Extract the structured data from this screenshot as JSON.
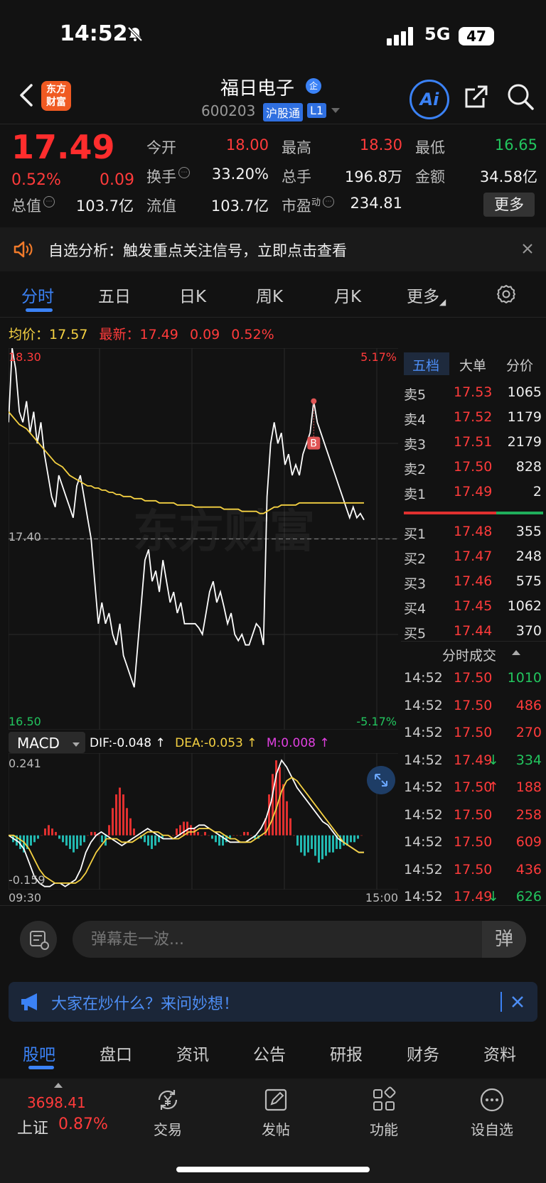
{
  "status": {
    "time": "14:52",
    "network": "5G",
    "battery": "47"
  },
  "header": {
    "logo_line1": "东方",
    "logo_line2": "财富",
    "name": "福日电子",
    "ent_badge": "企",
    "code": "600203",
    "badge_hgt": "沪股通",
    "badge_l1": "L1",
    "ai_label": "Ai"
  },
  "quote": {
    "price": "17.49",
    "change_pct": "0.52%",
    "change_amt": "0.09",
    "open_label": "今开",
    "open": "18.00",
    "high_label": "最高",
    "high": "18.30",
    "low_label": "最低",
    "low": "16.65",
    "turnover_label": "换手",
    "turnover": "33.20%",
    "volume_label": "总手",
    "volume": "196.8万",
    "amount_label": "金额",
    "amount": "34.58亿",
    "mcap_label": "总值",
    "mcap": "103.7亿",
    "float_label": "流值",
    "float_cap": "103.7亿",
    "pe_label": "市盈",
    "pe_sup": "动",
    "pe": "234.81",
    "more_label": "更多"
  },
  "notice": {
    "text": "自选分析：触发重点关注信号，立即点击查看"
  },
  "chart_tabs": [
    "分时",
    "五日",
    "日K",
    "周K",
    "月K",
    "更多"
  ],
  "avg_line": {
    "avg_label": "均价：",
    "avg": "17.57",
    "latest_label": "最新：",
    "latest": "17.49",
    "chg": "0.09",
    "pct": "0.52%"
  },
  "chart_data": [
    {
      "type": "line",
      "axis": {
        "y_top": "18.30",
        "y_mid": "17.40",
        "y_bottom": "16.50",
        "pct_top": "5.17%",
        "pct_bottom": "-5.17%",
        "x_start": "09:30",
        "x_end": "15:00",
        "ylim": [
          16.5,
          18.3
        ],
        "ref_price": 17.4
      },
      "watermark": "东方财富",
      "buy_marker": "B",
      "series": [
        {
          "color": "#ffffff",
          "values": [
            17.95,
            18.3,
            18.2,
            18.0,
            17.95,
            18.05,
            17.9,
            18.0,
            17.85,
            17.95,
            17.8,
            17.7,
            17.6,
            17.55,
            17.7,
            17.65,
            17.6,
            17.55,
            17.5,
            17.65,
            17.7,
            17.6,
            17.5,
            17.4,
            17.2,
            17.0,
            17.1,
            17.0,
            17.05,
            16.95,
            16.9,
            17.0,
            16.85,
            16.8,
            16.75,
            16.7,
            16.9,
            17.1,
            17.3,
            17.35,
            17.2,
            17.25,
            17.15,
            17.3,
            17.2,
            17.1,
            17.15,
            17.05,
            17.1,
            17.0,
            17.0,
            17.0,
            17.0,
            16.98,
            16.95,
            17.05,
            17.15,
            17.2,
            17.1,
            17.15,
            17.08,
            17.0,
            17.05,
            16.95,
            16.92,
            16.95,
            16.9,
            16.9,
            16.95,
            17.0,
            16.98,
            16.9,
            17.6,
            17.85,
            17.95,
            17.85,
            17.9,
            17.75,
            17.8,
            17.7,
            17.75,
            17.7,
            17.8,
            17.85,
            17.9,
            18.05,
            17.95,
            17.9,
            17.85,
            17.8,
            17.75,
            17.7,
            17.65,
            17.6,
            17.55,
            17.5,
            17.55,
            17.5,
            17.52,
            17.49
          ]
        },
        {
          "color": "#f5d142",
          "values": [
            18.0,
            17.98,
            17.96,
            17.94,
            17.93,
            17.92,
            17.9,
            17.88,
            17.86,
            17.84,
            17.82,
            17.8,
            17.78,
            17.76,
            17.75,
            17.74,
            17.72,
            17.7,
            17.69,
            17.68,
            17.67,
            17.66,
            17.65,
            17.65,
            17.64,
            17.64,
            17.63,
            17.63,
            17.62,
            17.62,
            17.61,
            17.61,
            17.6,
            17.6,
            17.6,
            17.59,
            17.59,
            17.59,
            17.58,
            17.58,
            17.58,
            17.58,
            17.57,
            17.57,
            17.57,
            17.57,
            17.57,
            17.56,
            17.56,
            17.56,
            17.56,
            17.56,
            17.55,
            17.55,
            17.55,
            17.55,
            17.55,
            17.55,
            17.55,
            17.55,
            17.54,
            17.54,
            17.54,
            17.54,
            17.54,
            17.53,
            17.53,
            17.53,
            17.53,
            17.53,
            17.52,
            17.52,
            17.53,
            17.54,
            17.55,
            17.55,
            17.56,
            17.56,
            17.56,
            17.56,
            17.56,
            17.57,
            17.57,
            17.57,
            17.57,
            17.57,
            17.57,
            17.57,
            17.57,
            17.57,
            17.57,
            17.57,
            17.57,
            17.57,
            17.57,
            17.57,
            17.57,
            17.57,
            17.57,
            17.57
          ]
        }
      ]
    },
    {
      "type": "bar",
      "title": "MACD",
      "axis": {
        "y_top": "0.241",
        "y_bottom": "-0.159",
        "x_start": "09:30",
        "x_end": "15:00",
        "ylim": [
          -0.159,
          0.241
        ]
      },
      "labels": {
        "dif": "DIF:-0.048 ↑",
        "dea": "DEA:-0.053 ↑",
        "m": "M:0.008 ↑"
      },
      "histogram": [
        0.0,
        -0.02,
        -0.03,
        -0.04,
        -0.05,
        -0.04,
        -0.03,
        -0.02,
        -0.01,
        0.0,
        0.02,
        0.03,
        0.02,
        0.01,
        -0.01,
        -0.02,
        -0.03,
        -0.04,
        -0.05,
        -0.04,
        -0.03,
        -0.02,
        0.0,
        0.01,
        0.01,
        0.0,
        -0.02,
        -0.03,
        0.03,
        0.08,
        0.12,
        0.14,
        0.12,
        0.08,
        0.05,
        0.02,
        0.0,
        -0.01,
        -0.02,
        -0.03,
        -0.04,
        -0.03,
        -0.02,
        -0.01,
        0.0,
        0.0,
        0.0,
        0.02,
        0.03,
        0.04,
        0.04,
        0.03,
        0.02,
        0.01,
        0.0,
        0.01,
        0.0,
        -0.01,
        -0.02,
        -0.03,
        -0.03,
        -0.02,
        -0.01,
        0.0,
        0.0,
        0.0,
        0.01,
        0.01,
        0.0,
        -0.01,
        -0.01,
        0.0,
        0.05,
        0.12,
        0.18,
        0.22,
        0.2,
        0.15,
        0.1,
        0.05,
        0.0,
        -0.03,
        -0.05,
        -0.06,
        -0.05,
        -0.04,
        -0.06,
        -0.08,
        -0.07,
        -0.06,
        -0.05,
        -0.05,
        -0.04,
        -0.04,
        -0.03,
        -0.03,
        -0.02,
        -0.02,
        -0.01,
        0.0
      ],
      "series": [
        {
          "name": "DIF",
          "color": "#ffffff",
          "values": [
            0.0,
            -0.01,
            -0.02,
            -0.04,
            -0.08,
            -0.12,
            -0.14,
            -0.15,
            -0.15,
            -0.14,
            -0.14,
            -0.15,
            -0.14,
            -0.13,
            -0.1,
            -0.05,
            -0.02,
            0.0,
            0.01,
            0.0,
            -0.01,
            -0.02,
            -0.03,
            -0.02,
            -0.01,
            0.0,
            0.01,
            0.02,
            0.01,
            0.0,
            -0.01,
            -0.01,
            -0.01,
            0.0,
            0.01,
            0.02,
            0.02,
            0.03,
            0.03,
            0.02,
            0.01,
            0.0,
            -0.01,
            -0.02,
            -0.02,
            -0.02,
            -0.02,
            -0.01,
            0.0,
            0.02,
            0.05,
            0.1,
            0.18,
            0.22,
            0.2,
            0.17,
            0.14,
            0.12,
            0.1,
            0.08,
            0.06,
            0.04,
            0.03,
            0.01,
            -0.01,
            -0.02,
            -0.03,
            -0.04,
            -0.05,
            -0.05
          ]
        },
        {
          "name": "DEA",
          "color": "#f5d142",
          "values": [
            0.0,
            0.0,
            -0.01,
            -0.02,
            -0.04,
            -0.07,
            -0.1,
            -0.12,
            -0.13,
            -0.14,
            -0.14,
            -0.14,
            -0.14,
            -0.14,
            -0.13,
            -0.11,
            -0.08,
            -0.05,
            -0.03,
            -0.01,
            -0.01,
            -0.01,
            -0.02,
            -0.02,
            -0.02,
            -0.01,
            0.0,
            0.01,
            0.01,
            0.01,
            0.0,
            0.0,
            -0.01,
            -0.01,
            0.0,
            0.01,
            0.01,
            0.02,
            0.02,
            0.02,
            0.01,
            0.01,
            0.0,
            -0.01,
            -0.01,
            -0.02,
            -0.02,
            -0.02,
            -0.01,
            0.0,
            0.01,
            0.04,
            0.08,
            0.13,
            0.16,
            0.17,
            0.16,
            0.14,
            0.12,
            0.1,
            0.08,
            0.06,
            0.04,
            0.02,
            0.0,
            -0.02,
            -0.03,
            -0.04,
            -0.05,
            -0.05
          ]
        }
      ]
    }
  ],
  "order_book": {
    "tabs": [
      "五档",
      "大单",
      "分价"
    ],
    "asks": [
      {
        "label": "卖5",
        "price": "17.53",
        "vol": "1065"
      },
      {
        "label": "卖4",
        "price": "17.52",
        "vol": "1179"
      },
      {
        "label": "卖3",
        "price": "17.51",
        "vol": "2179"
      },
      {
        "label": "卖2",
        "price": "17.50",
        "vol": "828"
      },
      {
        "label": "卖1",
        "price": "17.49",
        "vol": "2"
      }
    ],
    "bids": [
      {
        "label": "买1",
        "price": "17.48",
        "vol": "355"
      },
      {
        "label": "买2",
        "price": "17.47",
        "vol": "248"
      },
      {
        "label": "买3",
        "price": "17.46",
        "vol": "575"
      },
      {
        "label": "买4",
        "price": "17.45",
        "vol": "1062"
      },
      {
        "label": "买5",
        "price": "17.44",
        "vol": "370"
      }
    ],
    "trades_title": "分时成交",
    "trades": [
      {
        "time": "14:52",
        "price": "17.50",
        "vol": "1010",
        "vol_color": "green",
        "arrow": ""
      },
      {
        "time": "14:52",
        "price": "17.50",
        "vol": "486",
        "vol_color": "red",
        "arrow": ""
      },
      {
        "time": "14:52",
        "price": "17.50",
        "vol": "270",
        "vol_color": "red",
        "arrow": ""
      },
      {
        "time": "14:52",
        "price": "17.49",
        "vol": "334",
        "vol_color": "green",
        "arrow": "↓"
      },
      {
        "time": "14:52",
        "price": "17.50",
        "vol": "188",
        "vol_color": "red",
        "arrow": "↑"
      },
      {
        "time": "14:52",
        "price": "17.50",
        "vol": "258",
        "vol_color": "red",
        "arrow": ""
      },
      {
        "time": "14:52",
        "price": "17.50",
        "vol": "609",
        "vol_color": "red",
        "arrow": ""
      },
      {
        "time": "14:52",
        "price": "17.50",
        "vol": "436",
        "vol_color": "red",
        "arrow": ""
      },
      {
        "time": "14:52",
        "price": "17.49",
        "vol": "626",
        "vol_color": "green",
        "arrow": "↓"
      }
    ]
  },
  "comment": {
    "placeholder": "弹幕走一波...",
    "send_label": "弹"
  },
  "ask_banner": {
    "text": "大家在炒什么？来问妙想！"
  },
  "bottom_tabs": [
    "股吧",
    "盘口",
    "资讯",
    "公告",
    "研报",
    "财务",
    "资料"
  ],
  "index": {
    "value": "3698.41",
    "name": "上证",
    "chg": "0.87%"
  },
  "nav": [
    {
      "label": "交易",
      "icon": "yuan-exchange-icon"
    },
    {
      "label": "发帖",
      "icon": "edit-post-icon"
    },
    {
      "label": "功能",
      "icon": "apps-grid-icon"
    },
    {
      "label": "设自选",
      "icon": "more-dots-icon"
    }
  ],
  "colors": {
    "up": "#ff3b3b",
    "down": "#22c55e",
    "accent": "#3b82f6",
    "avg_line": "#f5d142"
  }
}
